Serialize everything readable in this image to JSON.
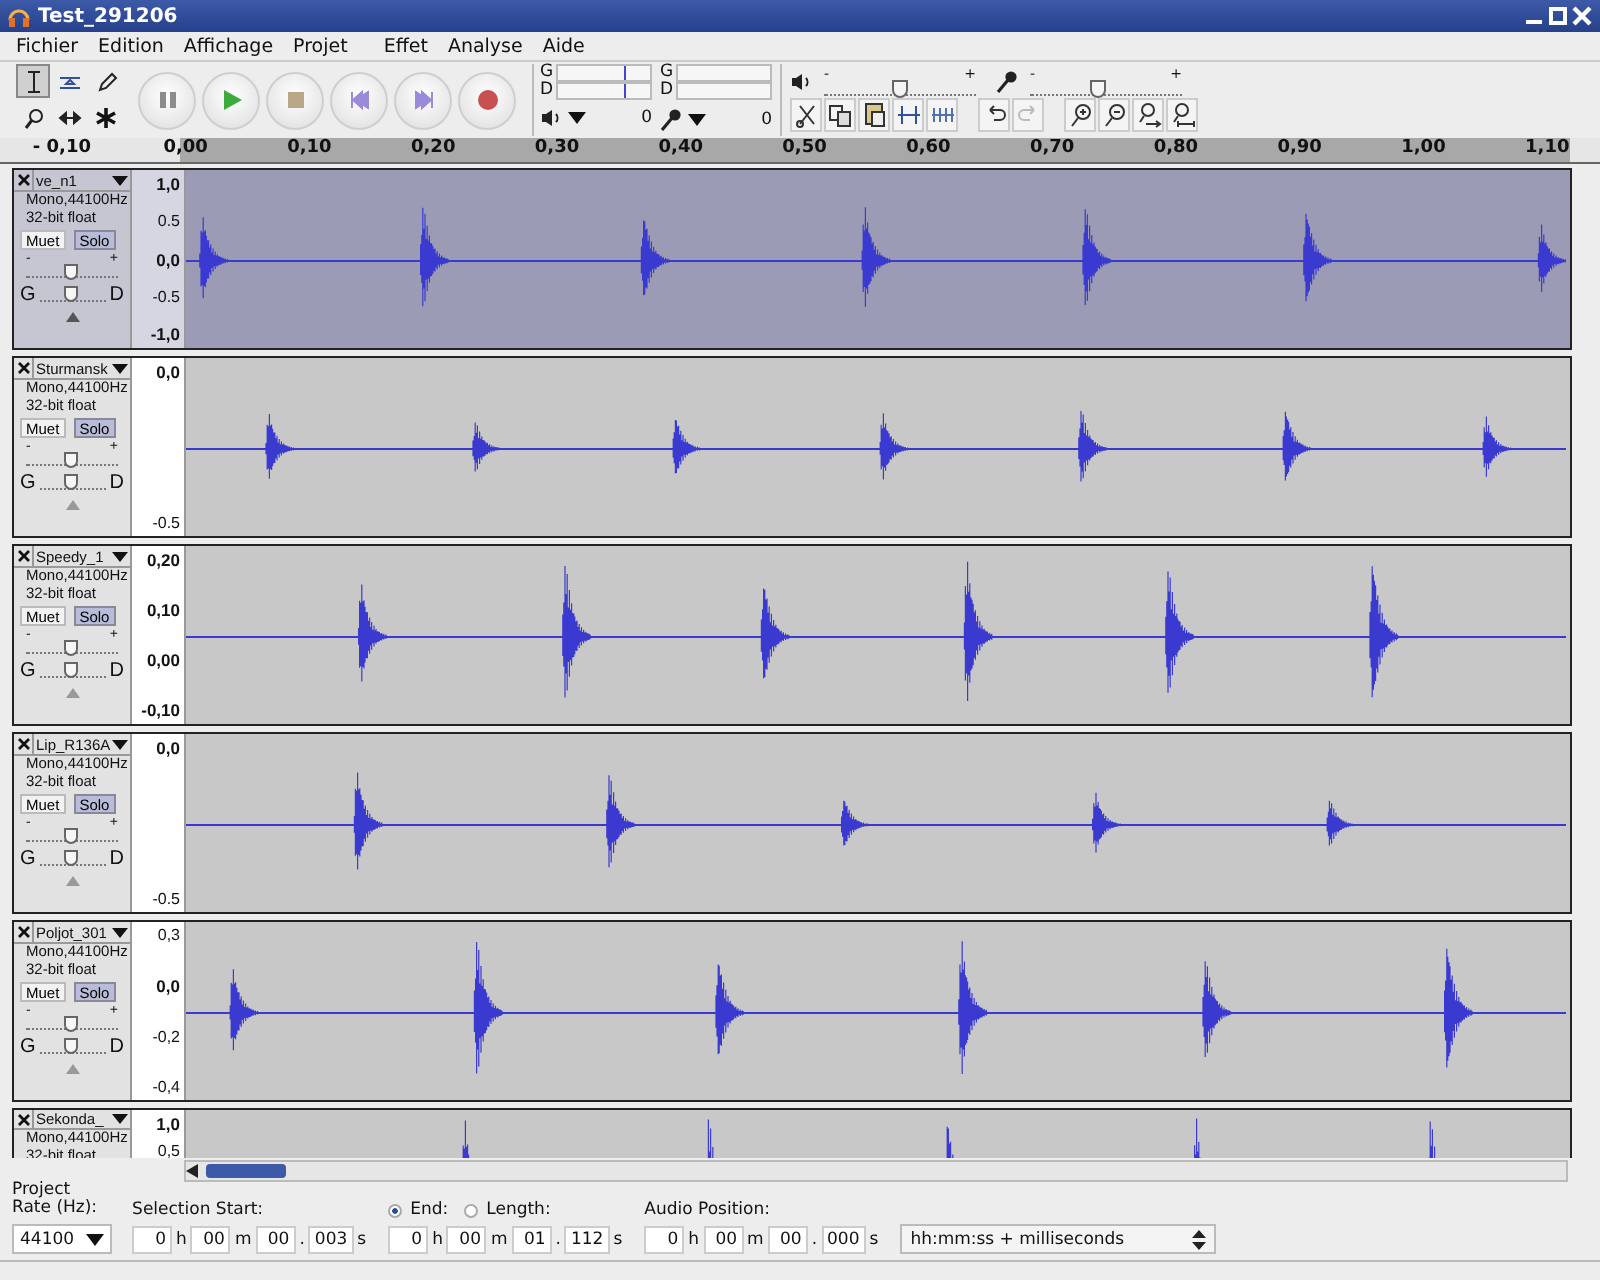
{
  "window": {
    "title": "Test_291206"
  },
  "menu": [
    {
      "label": "Fichier"
    },
    {
      "label": "Edition"
    },
    {
      "label": "Affichage"
    },
    {
      "label": "Projet"
    },
    {
      "label": "Effet"
    },
    {
      "label": "Analyse"
    },
    {
      "label": "Aide"
    }
  ],
  "tools": [
    {
      "kind": "ibeam",
      "selected": true
    },
    {
      "kind": "envelope",
      "selected": false
    },
    {
      "kind": "pencil",
      "selected": false
    },
    {
      "kind": "zoom",
      "selected": false
    },
    {
      "kind": "timeshift",
      "selected": false
    },
    {
      "kind": "multi",
      "selected": false
    }
  ],
  "transport": [
    {
      "kind": "pause"
    },
    {
      "kind": "play"
    },
    {
      "kind": "stop"
    },
    {
      "kind": "skip_start"
    },
    {
      "kind": "skip_end"
    },
    {
      "kind": "record"
    }
  ],
  "meters": [
    {
      "kind": "playback",
      "left": "G",
      "right": "D",
      "zero": "0"
    },
    {
      "kind": "recording",
      "left": "G",
      "right": "D",
      "zero": "0"
    }
  ],
  "mixer": [
    {
      "kind": "volume",
      "minus": "-",
      "plus": "+",
      "level": 0.5
    },
    {
      "kind": "mic",
      "minus": "-",
      "plus": "+",
      "level": 0.45
    }
  ],
  "edit_tools": [
    {
      "kind": "cut",
      "disabled": false
    },
    {
      "kind": "copy",
      "disabled": false
    },
    {
      "kind": "paste",
      "disabled": false
    },
    {
      "kind": "trim",
      "disabled": false
    },
    {
      "kind": "silence",
      "disabled": false
    },
    {
      "kind": "undo",
      "disabled": false
    },
    {
      "kind": "redo",
      "disabled": true
    },
    {
      "kind": "zoom_in",
      "disabled": false
    },
    {
      "kind": "zoom_out",
      "disabled": false
    },
    {
      "kind": "fit_selection",
      "disabled": false
    },
    {
      "kind": "fit_project",
      "disabled": false
    }
  ],
  "ruler": {
    "labels": [
      "- 0,10",
      "0,00",
      "0,10",
      "0,20",
      "0,30",
      "0,40",
      "0,50",
      "0,60",
      "0,70",
      "0,80",
      "0,90",
      "1,00",
      "1,10"
    ]
  },
  "tracks": [
    {
      "name": "ve_n1",
      "info": [
        "Mono,44100Hz",
        "32-bit float"
      ],
      "mute": "Muet",
      "solo": "Solo",
      "gain": {
        "minus": "-",
        "plus": "+"
      },
      "pan": {
        "left": "G",
        "right": "D"
      },
      "selected": true,
      "scale": [
        {
          "label": "1,0",
          "bold": true
        },
        {
          "label": "0.5",
          "bold": false
        },
        {
          "label": "0,0",
          "bold": true
        },
        {
          "label": "-0.5",
          "bold": false
        },
        {
          "label": "-1,0",
          "bold": true
        }
      ]
    },
    {
      "name": "Sturmansk",
      "info": [
        "Mono,44100Hz",
        "32-bit float"
      ],
      "mute": "Muet",
      "solo": "Solo",
      "gain": {
        "minus": "-",
        "plus": "+"
      },
      "pan": {
        "left": "G",
        "right": "D"
      },
      "selected": false,
      "scale": [
        {
          "label": "0,0",
          "bold": true
        },
        {
          "label": "-0.5",
          "bold": false
        }
      ]
    },
    {
      "name": "Speedy_1",
      "info": [
        "Mono,44100Hz",
        "32-bit float"
      ],
      "mute": "Muet",
      "solo": "Solo",
      "gain": {
        "minus": "-",
        "plus": "+"
      },
      "pan": {
        "left": "G",
        "right": "D"
      },
      "selected": false,
      "scale": [
        {
          "label": "0,20",
          "bold": true
        },
        {
          "label": "0,10",
          "bold": true
        },
        {
          "label": "0,00",
          "bold": true
        },
        {
          "label": "-0,10",
          "bold": true
        }
      ]
    },
    {
      "name": "Lip_R136A",
      "info": [
        "Mono,44100Hz",
        "32-bit float"
      ],
      "mute": "Muet",
      "solo": "Solo",
      "gain": {
        "minus": "-",
        "plus": "+"
      },
      "pan": {
        "left": "G",
        "right": "D"
      },
      "selected": false,
      "scale": [
        {
          "label": "0,0",
          "bold": true
        },
        {
          "label": "-0.5",
          "bold": false
        }
      ]
    },
    {
      "name": "Poljot_301",
      "info": [
        "Mono,44100Hz",
        "32-bit float"
      ],
      "mute": "Muet",
      "solo": "Solo",
      "gain": {
        "minus": "-",
        "plus": "+"
      },
      "pan": {
        "left": "G",
        "right": "D"
      },
      "selected": false,
      "scale": [
        {
          "label": "0,3",
          "bold": false
        },
        {
          "label": "0,0",
          "bold": true
        },
        {
          "label": "-0,2",
          "bold": false
        },
        {
          "label": "-0,4",
          "bold": false
        }
      ]
    },
    {
      "name": "Sekonda_",
      "info": [
        "Mono,44100Hz",
        "32-bit float"
      ],
      "selected": false,
      "scale": [
        {
          "label": "1,0",
          "bold": true
        },
        {
          "label": "0,5",
          "bold": false
        }
      ]
    }
  ],
  "bottom": {
    "project_rate": {
      "label": "Project Rate (Hz):",
      "value": "44100"
    },
    "selection_start": {
      "label": "Selection Start:",
      "time": [
        {
          "value": "0",
          "unit": "h"
        },
        {
          "value": "00",
          "unit": "m"
        },
        {
          "value": "00",
          "unit": "."
        },
        {
          "value": "003",
          "unit": "s"
        }
      ]
    },
    "end_modes": [
      {
        "label": "End:",
        "selected": true
      },
      {
        "label": "Length:",
        "selected": false
      }
    ],
    "end_time": [
      {
        "value": "0",
        "unit": "h"
      },
      {
        "value": "00",
        "unit": "m"
      },
      {
        "value": "01",
        "unit": "."
      },
      {
        "value": "112",
        "unit": "s"
      }
    ],
    "audio_position": {
      "label": "Audio Position:",
      "time": [
        {
          "value": "0",
          "unit": "h"
        },
        {
          "value": "00",
          "unit": "m"
        },
        {
          "value": "00",
          "unit": "."
        },
        {
          "value": "000",
          "unit": "s"
        }
      ]
    },
    "time_format": "hh:mm:ss + milliseconds"
  }
}
